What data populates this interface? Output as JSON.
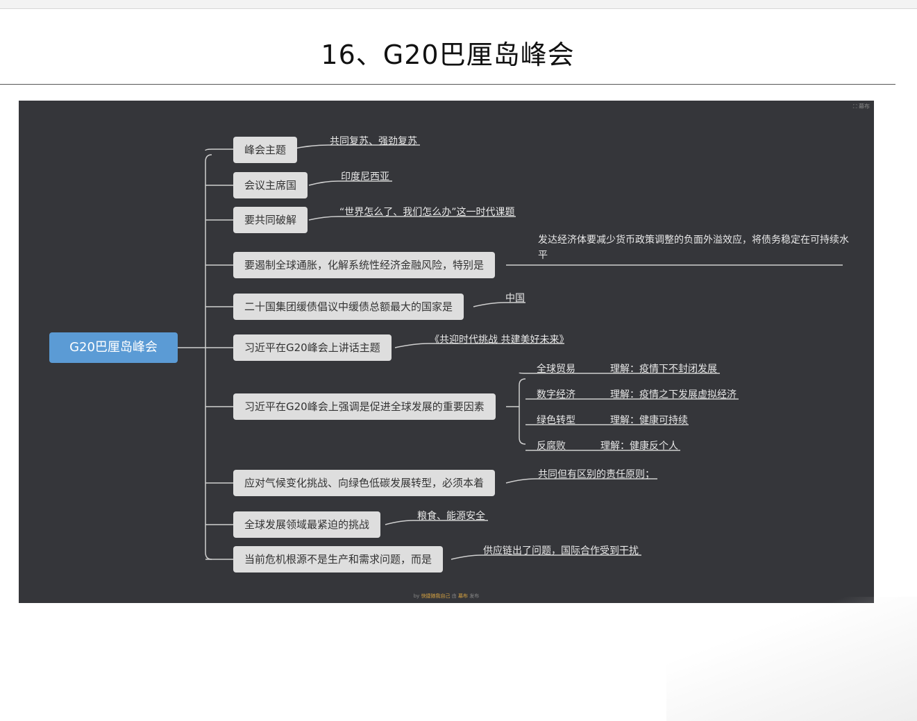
{
  "page_title": "16、G20巴厘岛峰会",
  "mindmap": {
    "root": "G20巴厘岛峰会",
    "branches": [
      {
        "label": "峰会主题",
        "answer": "共同复苏、强劲复苏"
      },
      {
        "label": "会议主席国",
        "answer": "印度尼西亚"
      },
      {
        "label": "要共同破解",
        "answer": "“世界怎么了、我们怎么办”这一时代课题"
      },
      {
        "label": "要遏制全球通胀，化解系统性经济金融风险，特别是",
        "answer": "发达经济体要减少货币政策调整的负面外溢效应，将债务稳定在可持续水平"
      },
      {
        "label": "二十国集团缓债倡议中缓债总额最大的国家是",
        "answer": "中国"
      },
      {
        "label": "习近平在G20峰会上讲话主题",
        "answer": "《共迎时代挑战 共建美好未来》"
      },
      {
        "label": "习近平在G20峰会上强调是促进全球发展的重要因素",
        "factors": [
          {
            "name": "全球贸易",
            "note": "理解：疫情下不封闭发展"
          },
          {
            "name": "数字经济",
            "note": "理解：疫情之下发展虚拟经济"
          },
          {
            "name": "绿色转型",
            "note": "理解：健康可持续"
          },
          {
            "name": "反腐败",
            "note": "理解：健康反个人"
          }
        ]
      },
      {
        "label": "应对气候变化挑战、向绿色低碳发展转型，必须本着",
        "answer": "共同但有区别的责任原则；"
      },
      {
        "label": "全球发展领域最紧迫的挑战",
        "answer": "粮食、能源安全"
      },
      {
        "label": "当前危机根源不是生产和需求问题，而是",
        "answer": "供应链出了问题，国际合作受到干扰"
      }
    ]
  },
  "footer": {
    "by": "by",
    "author": "快捷随我自己",
    "via": "由",
    "tool": "幕布",
    "suffix": "发布"
  },
  "publish_badge": "幕布"
}
